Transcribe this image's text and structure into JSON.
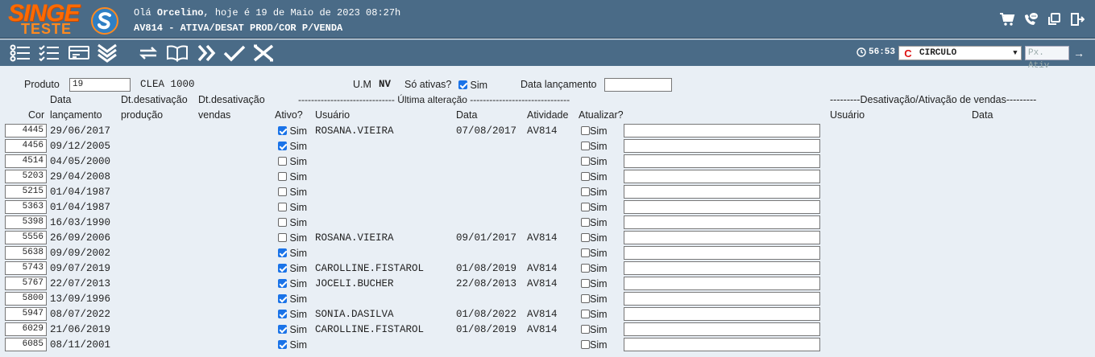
{
  "header": {
    "logo_text": "SINGE",
    "logo_sub": "TESTE",
    "greeting_prefix": "Olá",
    "user_name": "Orcelino",
    "greeting_suffix": ", hoje é 19 de Maio de 2023 08:27h",
    "program_title": "AV814 - ATIVA/DESAT PROD/COR P/VENDA",
    "icons": [
      "cart-icon",
      "phone-chat-icon",
      "windows-icon",
      "exit-icon"
    ]
  },
  "toolbar": {
    "buttons": [
      "list-icon",
      "checklist-icon",
      "card-icon",
      "double-down-icon",
      "refresh-icon",
      "book-icon",
      "fast-forward-icon",
      "confirm-icon",
      "cancel-icon"
    ],
    "timer": "56:53",
    "empresa": "CIRCULO",
    "empresa_logo": "C",
    "px_ativ_placeholder": "Px. Ativ",
    "accent": "#4a6b87"
  },
  "filters": {
    "produto_label": "Produto",
    "produto_value": "19",
    "produto_desc": "CLEA 1000",
    "um_label": "U.M",
    "um_value": "NV",
    "so_ativas_label": "Só ativas?",
    "so_ativas_option": "Sim",
    "so_ativas_checked": true,
    "data_lancamento_label": "Data lançamento",
    "data_lancamento_value": ""
  },
  "headers": {
    "cor": "Cor",
    "data_line1": "Data",
    "data_line2": "lançamento",
    "dt_prod_line1": "Dt.desativação",
    "dt_prod_line2": "produção",
    "dt_vend_line1": "Dt.desativação",
    "dt_vend_line2": "vendas",
    "ultima_alteracao": "------------------------------ Última alteração -------------------------------",
    "ativo": "Ativo?",
    "usuario": "Usuário",
    "data": "Data",
    "atividade": "Atividade",
    "atualizar": "Atualizar?",
    "desat_ativ_vendas": "---------Desativação/Ativação de vendas---------",
    "usuario2": "Usuário",
    "data2": "Data"
  },
  "sim_label": "Sim",
  "rows": [
    {
      "cor": "4445",
      "data_lanc": "29/06/2017",
      "ativo": true,
      "usuario": "ROSANA.VIEIRA",
      "data": "07/08/2017",
      "atividade": "AV814"
    },
    {
      "cor": "4456",
      "data_lanc": "09/12/2005",
      "ativo": true,
      "usuario": "",
      "data": "",
      "atividade": ""
    },
    {
      "cor": "4514",
      "data_lanc": "04/05/2000",
      "ativo": false,
      "usuario": "",
      "data": "",
      "atividade": ""
    },
    {
      "cor": "5203",
      "data_lanc": "29/04/2008",
      "ativo": false,
      "usuario": "",
      "data": "",
      "atividade": ""
    },
    {
      "cor": "5215",
      "data_lanc": "01/04/1987",
      "ativo": false,
      "usuario": "",
      "data": "",
      "atividade": ""
    },
    {
      "cor": "5363",
      "data_lanc": "01/04/1987",
      "ativo": false,
      "usuario": "",
      "data": "",
      "atividade": ""
    },
    {
      "cor": "5398",
      "data_lanc": "16/03/1990",
      "ativo": false,
      "usuario": "",
      "data": "",
      "atividade": ""
    },
    {
      "cor": "5556",
      "data_lanc": "26/09/2006",
      "ativo": false,
      "usuario": "ROSANA.VIEIRA",
      "data": "09/01/2017",
      "atividade": "AV814"
    },
    {
      "cor": "5638",
      "data_lanc": "09/09/2002",
      "ativo": true,
      "usuario": "",
      "data": "",
      "atividade": ""
    },
    {
      "cor": "5743",
      "data_lanc": "09/07/2019",
      "ativo": true,
      "usuario": "CAROLLINE.FISTAROL",
      "data": "01/08/2019",
      "atividade": "AV814"
    },
    {
      "cor": "5767",
      "data_lanc": "22/07/2013",
      "ativo": true,
      "usuario": "JOCELI.BUCHER",
      "data": "22/08/2013",
      "atividade": "AV814"
    },
    {
      "cor": "5800",
      "data_lanc": "13/09/1996",
      "ativo": true,
      "usuario": "",
      "data": "",
      "atividade": ""
    },
    {
      "cor": "5947",
      "data_lanc": "08/07/2022",
      "ativo": true,
      "usuario": "SONIA.DASILVA",
      "data": "01/08/2022",
      "atividade": "AV814"
    },
    {
      "cor": "6029",
      "data_lanc": "21/06/2019",
      "ativo": true,
      "usuario": "CAROLLINE.FISTAROL",
      "data": "01/08/2019",
      "atividade": "AV814"
    },
    {
      "cor": "6085",
      "data_lanc": "08/11/2001",
      "ativo": true,
      "usuario": "",
      "data": "",
      "atividade": ""
    }
  ]
}
